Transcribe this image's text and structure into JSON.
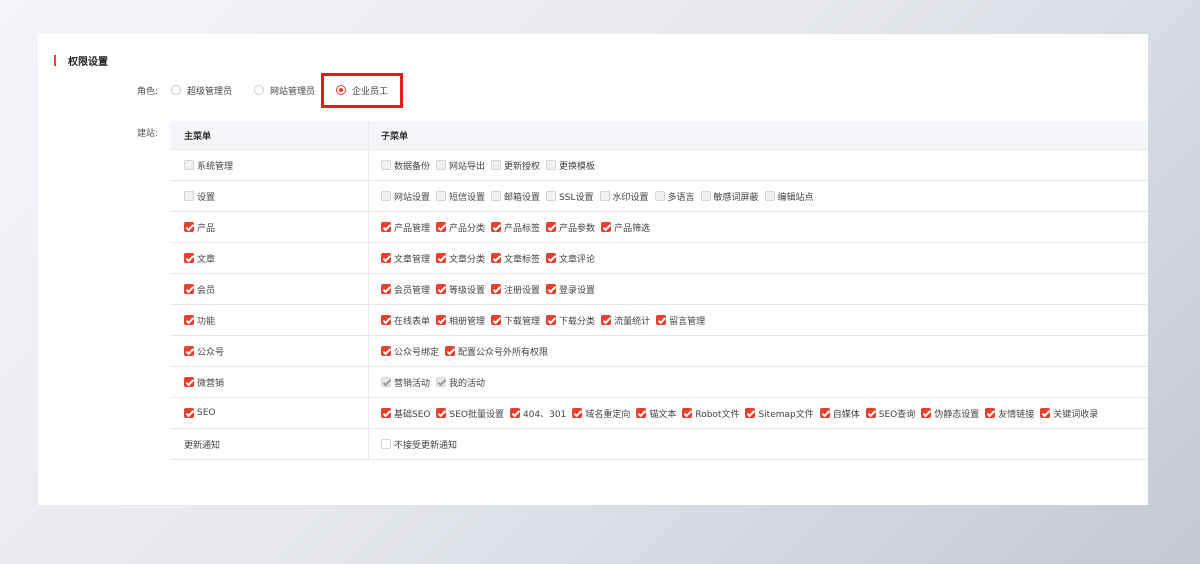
{
  "section_title": "权限设置",
  "role": {
    "label": "角色:",
    "options": [
      {
        "label": "超级管理员",
        "selected": false
      },
      {
        "label": "网站管理员",
        "selected": false
      },
      {
        "label": "企业员工",
        "selected": true
      }
    ]
  },
  "site": {
    "label": "建站:",
    "header": {
      "main": "主菜单",
      "sub": "子菜单"
    },
    "rows": [
      {
        "main": "系统管理",
        "main_state": "disabled",
        "subs": [
          {
            "label": "数据备份",
            "state": "disabled"
          },
          {
            "label": "网站导出",
            "state": "disabled"
          },
          {
            "label": "更新授权",
            "state": "disabled"
          },
          {
            "label": "更换模板",
            "state": "disabled"
          }
        ]
      },
      {
        "main": "设置",
        "main_state": "disabled",
        "subs": [
          {
            "label": "网站设置",
            "state": "disabled"
          },
          {
            "label": "短信设置",
            "state": "disabled"
          },
          {
            "label": "邮箱设置",
            "state": "disabled"
          },
          {
            "label": "SSL设置",
            "state": "disabled"
          },
          {
            "label": "水印设置",
            "state": "disabled"
          },
          {
            "label": "多语言",
            "state": "disabled"
          },
          {
            "label": "敏感词屏蔽",
            "state": "disabled"
          },
          {
            "label": "编辑站点",
            "state": "disabled"
          }
        ]
      },
      {
        "main": "产品",
        "main_state": "checked",
        "subs": [
          {
            "label": "产品管理",
            "state": "checked"
          },
          {
            "label": "产品分类",
            "state": "checked"
          },
          {
            "label": "产品标签",
            "state": "checked"
          },
          {
            "label": "产品参数",
            "state": "checked"
          },
          {
            "label": "产品筛选",
            "state": "checked"
          }
        ]
      },
      {
        "main": "文章",
        "main_state": "checked",
        "subs": [
          {
            "label": "文章管理",
            "state": "checked"
          },
          {
            "label": "文章分类",
            "state": "checked"
          },
          {
            "label": "文章标签",
            "state": "checked"
          },
          {
            "label": "文章评论",
            "state": "checked"
          }
        ]
      },
      {
        "main": "会员",
        "main_state": "checked",
        "subs": [
          {
            "label": "会员管理",
            "state": "checked"
          },
          {
            "label": "等级设置",
            "state": "checked"
          },
          {
            "label": "注册设置",
            "state": "checked"
          },
          {
            "label": "登录设置",
            "state": "checked"
          }
        ]
      },
      {
        "main": "功能",
        "main_state": "checked",
        "subs": [
          {
            "label": "在线表单",
            "state": "checked"
          },
          {
            "label": "相册管理",
            "state": "checked"
          },
          {
            "label": "下载管理",
            "state": "checked"
          },
          {
            "label": "下载分类",
            "state": "checked"
          },
          {
            "label": "流量统计",
            "state": "checked"
          },
          {
            "label": "留言管理",
            "state": "checked"
          }
        ]
      },
      {
        "main": "公众号",
        "main_state": "checked",
        "subs": [
          {
            "label": "公众号绑定",
            "state": "checked"
          },
          {
            "label": "配置公众号外所有权限",
            "state": "checked"
          }
        ]
      },
      {
        "main": "微营销",
        "main_state": "checked",
        "subs": [
          {
            "label": "营销活动",
            "state": "checked-disabled"
          },
          {
            "label": "我的活动",
            "state": "checked-disabled"
          }
        ]
      },
      {
        "main": "SEO",
        "main_state": "checked",
        "subs": [
          {
            "label": "基础SEO",
            "state": "checked"
          },
          {
            "label": "SEO批量设置",
            "state": "checked"
          },
          {
            "label": "404、301",
            "state": "checked"
          },
          {
            "label": "域名重定向",
            "state": "checked"
          },
          {
            "label": "锚文本",
            "state": "checked"
          },
          {
            "label": "Robot文件",
            "state": "checked"
          },
          {
            "label": "Sitemap文件",
            "state": "checked"
          },
          {
            "label": "自媒体",
            "state": "checked"
          },
          {
            "label": "SEO查询",
            "state": "checked"
          },
          {
            "label": "伪静态设置",
            "state": "checked"
          },
          {
            "label": "友情链接",
            "state": "checked"
          },
          {
            "label": "关键词收录",
            "state": "checked"
          }
        ]
      },
      {
        "main": "更新通知",
        "main_state": "none",
        "subs": [
          {
            "label": "不接受更新通知",
            "state": "unchecked"
          }
        ]
      }
    ]
  },
  "colors": {
    "accent": "#e8402e",
    "highlight": "#e01d1d"
  }
}
